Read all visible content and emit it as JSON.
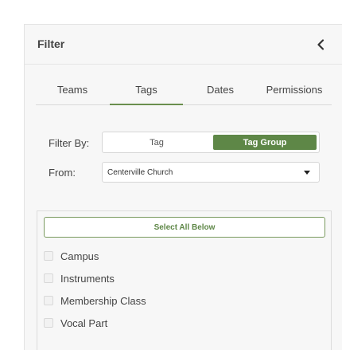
{
  "header": {
    "title": "Filter",
    "collapse_icon": "chevron-left-icon"
  },
  "tabs": [
    {
      "label": "Teams",
      "active": false
    },
    {
      "label": "Tags",
      "active": true
    },
    {
      "label": "Dates",
      "active": false
    },
    {
      "label": "Permissions",
      "active": false
    }
  ],
  "filter_by": {
    "label": "Filter By:",
    "options": [
      "Tag",
      "Tag Group"
    ],
    "selected": "Tag Group"
  },
  "from": {
    "label": "From:",
    "value": "Centerville Church"
  },
  "list": {
    "select_all_label": "Select All Below",
    "items": [
      "Campus",
      "Instruments",
      "Membership Class",
      "Vocal Part"
    ]
  },
  "colors": {
    "accent": "#5e8747",
    "panel_bg": "#f7f7f7"
  }
}
